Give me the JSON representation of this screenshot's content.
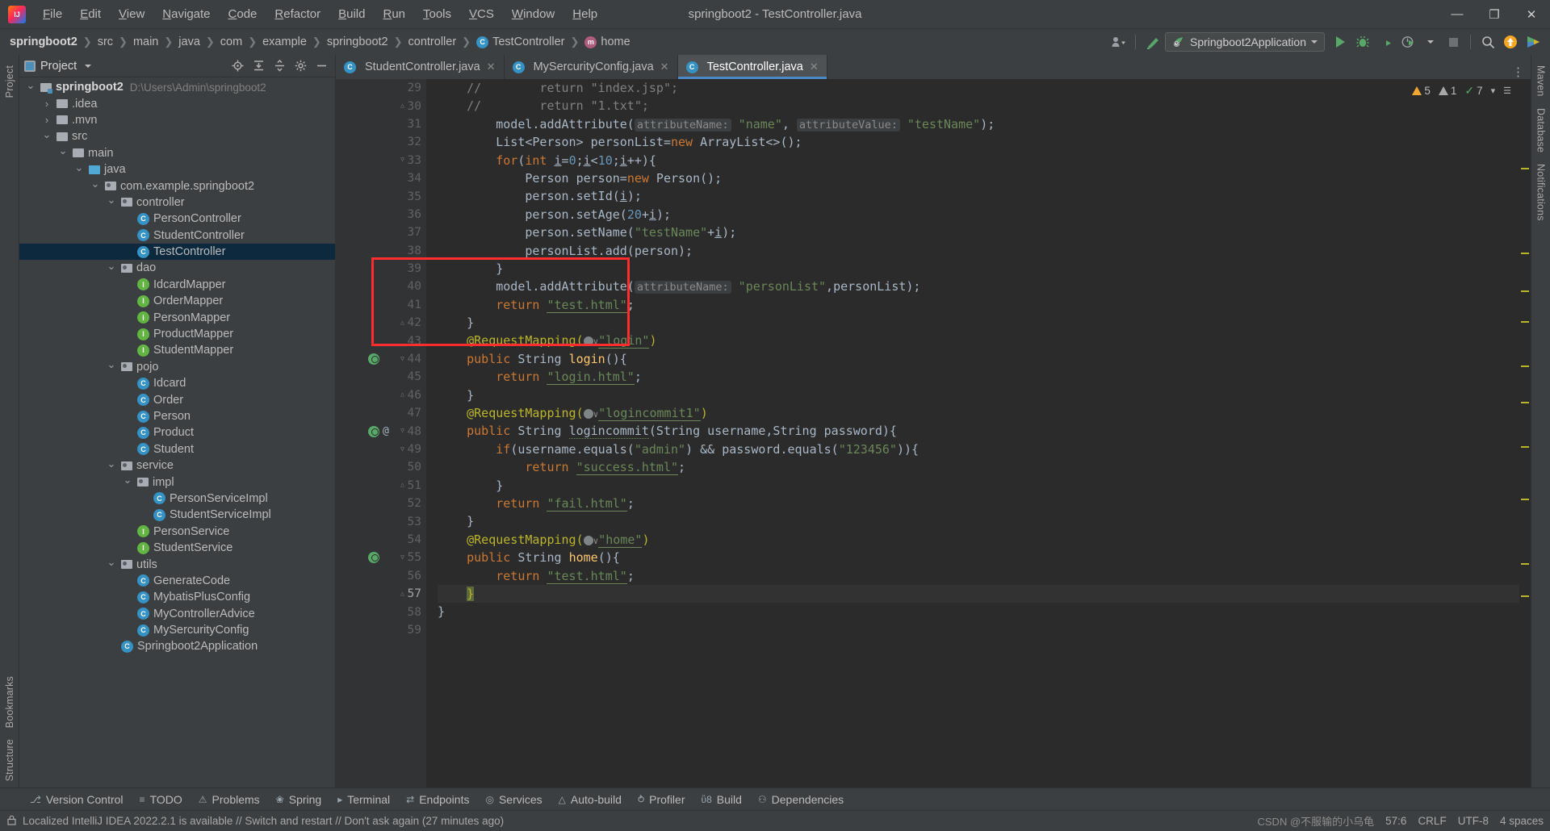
{
  "window": {
    "title": "springboot2 - TestController.java",
    "minimize": "—",
    "maximize": "❐",
    "close": "✕"
  },
  "menubar": {
    "items": [
      "File",
      "Edit",
      "View",
      "Navigate",
      "Code",
      "Refactor",
      "Build",
      "Run",
      "Tools",
      "VCS",
      "Window",
      "Help"
    ]
  },
  "navbar": {
    "crumbs": [
      {
        "label": "springboot2",
        "icon": "",
        "bold": true
      },
      {
        "label": "src",
        "icon": ""
      },
      {
        "label": "main",
        "icon": ""
      },
      {
        "label": "java",
        "icon": ""
      },
      {
        "label": "com",
        "icon": ""
      },
      {
        "label": "example",
        "icon": ""
      },
      {
        "label": "springboot2",
        "icon": ""
      },
      {
        "label": "controller",
        "icon": ""
      },
      {
        "label": "TestController",
        "icon": "class-icon",
        "badge": "C"
      },
      {
        "label": "home",
        "icon": "method-icon",
        "badge": "m"
      }
    ],
    "run_config": "Springboot2Application",
    "icons": {
      "profile": "user-account-icon",
      "hammer": "build-icon",
      "run": "run-icon",
      "debug": "debug-icon",
      "run_coverage": "run-with-coverage-icon",
      "profiler": "profiler-icon",
      "stop": "stop-icon",
      "search": "search-everywhere-icon",
      "update": "update-project-icon",
      "ide_feature": "ide-feature-trainer-icon"
    }
  },
  "project_panel": {
    "title": "Project",
    "tools": [
      "select-opened-file-icon",
      "expand-all-icon",
      "collapse-all-icon",
      "settings-icon",
      "hide-icon"
    ],
    "tree": [
      {
        "depth": 0,
        "label": "springboot2",
        "path": "D:\\Users\\Admin\\springboot2",
        "kind": "module",
        "arrow": "open",
        "bold": true
      },
      {
        "depth": 1,
        "label": ".idea",
        "kind": "folder",
        "arrow": "closed"
      },
      {
        "depth": 1,
        "label": ".mvn",
        "kind": "folder",
        "arrow": "closed"
      },
      {
        "depth": 1,
        "label": "src",
        "kind": "folder",
        "arrow": "open"
      },
      {
        "depth": 2,
        "label": "main",
        "kind": "folder",
        "arrow": "open"
      },
      {
        "depth": 3,
        "label": "java",
        "kind": "source-folder",
        "arrow": "open"
      },
      {
        "depth": 4,
        "label": "com.example.springboot2",
        "kind": "package",
        "arrow": "open"
      },
      {
        "depth": 5,
        "label": "controller",
        "kind": "package",
        "arrow": "open"
      },
      {
        "depth": 6,
        "label": "PersonController",
        "kind": "class"
      },
      {
        "depth": 6,
        "label": "StudentController",
        "kind": "class"
      },
      {
        "depth": 6,
        "label": "TestController",
        "kind": "class",
        "selected": true
      },
      {
        "depth": 5,
        "label": "dao",
        "kind": "package",
        "arrow": "open"
      },
      {
        "depth": 6,
        "label": "IdcardMapper",
        "kind": "interface"
      },
      {
        "depth": 6,
        "label": "OrderMapper",
        "kind": "interface"
      },
      {
        "depth": 6,
        "label": "PersonMapper",
        "kind": "interface"
      },
      {
        "depth": 6,
        "label": "ProductMapper",
        "kind": "interface"
      },
      {
        "depth": 6,
        "label": "StudentMapper",
        "kind": "interface"
      },
      {
        "depth": 5,
        "label": "pojo",
        "kind": "package",
        "arrow": "open"
      },
      {
        "depth": 6,
        "label": "Idcard",
        "kind": "class"
      },
      {
        "depth": 6,
        "label": "Order",
        "kind": "class"
      },
      {
        "depth": 6,
        "label": "Person",
        "kind": "class"
      },
      {
        "depth": 6,
        "label": "Product",
        "kind": "class"
      },
      {
        "depth": 6,
        "label": "Student",
        "kind": "class"
      },
      {
        "depth": 5,
        "label": "service",
        "kind": "package",
        "arrow": "open"
      },
      {
        "depth": 6,
        "label": "impl",
        "kind": "package",
        "arrow": "open"
      },
      {
        "depth": 7,
        "label": "PersonServiceImpl",
        "kind": "class"
      },
      {
        "depth": 7,
        "label": "StudentServiceImpl",
        "kind": "class"
      },
      {
        "depth": 6,
        "label": "PersonService",
        "kind": "interface"
      },
      {
        "depth": 6,
        "label": "StudentService",
        "kind": "interface"
      },
      {
        "depth": 5,
        "label": "utils",
        "kind": "package",
        "arrow": "open"
      },
      {
        "depth": 6,
        "label": "GenerateCode",
        "kind": "class"
      },
      {
        "depth": 6,
        "label": "MybatisPlusConfig",
        "kind": "class"
      },
      {
        "depth": 6,
        "label": "MyControllerAdvice",
        "kind": "class"
      },
      {
        "depth": 6,
        "label": "MySercurityConfig",
        "kind": "class"
      },
      {
        "depth": 5,
        "label": "Springboot2Application",
        "kind": "class-run"
      }
    ]
  },
  "editor": {
    "tabs": [
      {
        "label": "StudentController.java",
        "active": false,
        "badge": "C"
      },
      {
        "label": "MySercurityConfig.java",
        "active": false,
        "badge": "C"
      },
      {
        "label": "TestController.java",
        "active": true,
        "badge": "C"
      }
    ],
    "inspection": {
      "warnings": "5",
      "weak_warnings": "1",
      "typos": "7"
    },
    "first_line": 29,
    "lines": [
      {
        "n": 29,
        "indent": 0,
        "tokens": [
          {
            "t": "    ",
            "c": ""
          },
          {
            "t": "//",
            "c": "cmt"
          },
          {
            "t": "        return \"index.jsp\";",
            "c": "cmt"
          }
        ]
      },
      {
        "n": 30,
        "indent": 0,
        "fold": "end",
        "tokens": [
          {
            "t": "    ",
            "c": ""
          },
          {
            "t": "//",
            "c": "cmt"
          },
          {
            "t": "        return \"1.txt\";",
            "c": "cmt"
          }
        ]
      },
      {
        "n": 31,
        "tokens": [
          {
            "t": "        model.addAttribute(",
            "c": "fn"
          },
          {
            "t": "attributeName:",
            "c": "hint"
          },
          {
            "t": " ",
            "c": ""
          },
          {
            "t": "\"name\"",
            "c": "str"
          },
          {
            "t": ", ",
            "c": "fn"
          },
          {
            "t": "attributeValue:",
            "c": "hint"
          },
          {
            "t": " ",
            "c": ""
          },
          {
            "t": "\"testName\"",
            "c": "str"
          },
          {
            "t": ");",
            "c": "fn"
          }
        ]
      },
      {
        "n": 32,
        "tokens": [
          {
            "t": "        List<Person> personList=",
            "c": "fn"
          },
          {
            "t": "new",
            "c": "kw"
          },
          {
            "t": " ArrayList<>();",
            "c": "fn"
          }
        ]
      },
      {
        "n": 33,
        "fold": "start",
        "tokens": [
          {
            "t": "        ",
            "c": ""
          },
          {
            "t": "for",
            "c": "kw"
          },
          {
            "t": "(",
            "c": "fn"
          },
          {
            "t": "int",
            "c": "kw"
          },
          {
            "t": " ",
            "c": ""
          },
          {
            "t": "i",
            "c": "undl"
          },
          {
            "t": "=",
            "c": "fn"
          },
          {
            "t": "0",
            "c": "num"
          },
          {
            "t": ";",
            "c": "fn"
          },
          {
            "t": "i",
            "c": "undl"
          },
          {
            "t": "<",
            "c": "fn"
          },
          {
            "t": "10",
            "c": "num"
          },
          {
            "t": ";",
            "c": "fn"
          },
          {
            "t": "i",
            "c": "undl"
          },
          {
            "t": "++){",
            "c": "fn"
          }
        ]
      },
      {
        "n": 34,
        "tokens": [
          {
            "t": "            Person person=",
            "c": "fn"
          },
          {
            "t": "new",
            "c": "kw"
          },
          {
            "t": " Person();",
            "c": "fn"
          }
        ]
      },
      {
        "n": 35,
        "tokens": [
          {
            "t": "            person.setId(",
            "c": "fn"
          },
          {
            "t": "i",
            "c": "undl"
          },
          {
            "t": ");",
            "c": "fn"
          }
        ]
      },
      {
        "n": 36,
        "tokens": [
          {
            "t": "            person.setAge(",
            "c": "fn"
          },
          {
            "t": "20",
            "c": "num"
          },
          {
            "t": "+",
            "c": "fn"
          },
          {
            "t": "i",
            "c": "undl"
          },
          {
            "t": ");",
            "c": "fn"
          }
        ]
      },
      {
        "n": 37,
        "tokens": [
          {
            "t": "            person.setName(",
            "c": "fn"
          },
          {
            "t": "\"testName\"",
            "c": "str"
          },
          {
            "t": "+",
            "c": "fn"
          },
          {
            "t": "i",
            "c": "undl"
          },
          {
            "t": ");",
            "c": "fn"
          }
        ]
      },
      {
        "n": 38,
        "tokens": [
          {
            "t": "            personList.add(person);",
            "c": "fn"
          }
        ]
      },
      {
        "n": 39,
        "tokens": [
          {
            "t": "        }",
            "c": "fn"
          }
        ]
      },
      {
        "n": 40,
        "tokens": [
          {
            "t": "        model.addAttribute(",
            "c": "fn"
          },
          {
            "t": "attributeName:",
            "c": "hint"
          },
          {
            "t": " ",
            "c": ""
          },
          {
            "t": "\"personList\"",
            "c": "str"
          },
          {
            "t": ",personList);",
            "c": "fn"
          }
        ]
      },
      {
        "n": 41,
        "tokens": [
          {
            "t": "        ",
            "c": ""
          },
          {
            "t": "return",
            "c": "kw"
          },
          {
            "t": " ",
            "c": ""
          },
          {
            "t": "\"test.html\"",
            "c": "strl"
          },
          {
            "t": ";",
            "c": "fn"
          }
        ]
      },
      {
        "n": 42,
        "fold": "end",
        "tokens": [
          {
            "t": "    }",
            "c": "fn"
          }
        ]
      },
      {
        "n": 43,
        "tokens": [
          {
            "t": "    @RequestMapping(",
            "c": "ann"
          },
          {
            "t": "GLOBE",
            "c": "globe"
          },
          {
            "t": "\"login\"",
            "c": "strl"
          },
          {
            "t": ")",
            "c": "ann"
          }
        ]
      },
      {
        "n": 44,
        "run": true,
        "fold": "start",
        "tokens": [
          {
            "t": "    ",
            "c": ""
          },
          {
            "t": "public",
            "c": "kw"
          },
          {
            "t": " String ",
            "c": "cls"
          },
          {
            "t": "login",
            "c": "mth"
          },
          {
            "t": "(){",
            "c": "fn"
          }
        ]
      },
      {
        "n": 45,
        "tokens": [
          {
            "t": "        ",
            "c": ""
          },
          {
            "t": "return",
            "c": "kw"
          },
          {
            "t": " ",
            "c": ""
          },
          {
            "t": "\"login.html\"",
            "c": "strl"
          },
          {
            "t": ";",
            "c": "fn"
          }
        ]
      },
      {
        "n": 46,
        "fold": "end",
        "tokens": [
          {
            "t": "    }",
            "c": "fn"
          }
        ]
      },
      {
        "n": 47,
        "tokens": [
          {
            "t": "    @RequestMapping(",
            "c": "ann"
          },
          {
            "t": "GLOBE",
            "c": "globe"
          },
          {
            "t": "\"logincommit1\"",
            "c": "strl"
          },
          {
            "t": ")",
            "c": "ann"
          }
        ]
      },
      {
        "n": 48,
        "run": true,
        "at": true,
        "fold": "start",
        "tokens": [
          {
            "t": "    ",
            "c": ""
          },
          {
            "t": "public",
            "c": "kw"
          },
          {
            "t": " String ",
            "c": "cls"
          },
          {
            "t": "logincommit",
            "c": "squig"
          },
          {
            "t": "(String username,String password){",
            "c": "fn"
          }
        ]
      },
      {
        "n": 49,
        "fold": "start",
        "tokens": [
          {
            "t": "        ",
            "c": ""
          },
          {
            "t": "if",
            "c": "kw"
          },
          {
            "t": "(username.equals(",
            "c": "fn"
          },
          {
            "t": "\"admin\"",
            "c": "str"
          },
          {
            "t": ") && password.equals(",
            "c": "fn"
          },
          {
            "t": "\"123456\"",
            "c": "str"
          },
          {
            "t": ")){",
            "c": "fn"
          }
        ]
      },
      {
        "n": 50,
        "tokens": [
          {
            "t": "            ",
            "c": ""
          },
          {
            "t": "return",
            "c": "kw"
          },
          {
            "t": " ",
            "c": ""
          },
          {
            "t": "\"success.html\"",
            "c": "strl"
          },
          {
            "t": ";",
            "c": "fn"
          }
        ]
      },
      {
        "n": 51,
        "fold": "end",
        "tokens": [
          {
            "t": "        }",
            "c": "fn"
          }
        ]
      },
      {
        "n": 52,
        "tokens": [
          {
            "t": "        ",
            "c": ""
          },
          {
            "t": "return",
            "c": "kw"
          },
          {
            "t": " ",
            "c": ""
          },
          {
            "t": "\"fail.html\"",
            "c": "strl"
          },
          {
            "t": ";",
            "c": "fn"
          }
        ]
      },
      {
        "n": 53,
        "tokens": [
          {
            "t": "    }",
            "c": "fn"
          }
        ]
      },
      {
        "n": 54,
        "tokens": [
          {
            "t": "    @RequestMapping(",
            "c": "ann"
          },
          {
            "t": "GLOBE",
            "c": "globe"
          },
          {
            "t": "\"home\"",
            "c": "strl"
          },
          {
            "t": ")",
            "c": "ann"
          }
        ]
      },
      {
        "n": 55,
        "run": true,
        "fold": "start",
        "tokens": [
          {
            "t": "    ",
            "c": ""
          },
          {
            "t": "public",
            "c": "kw"
          },
          {
            "t": " String ",
            "c": "cls"
          },
          {
            "t": "home",
            "c": "mth"
          },
          {
            "t": "(){",
            "c": "fn"
          }
        ]
      },
      {
        "n": 56,
        "tokens": [
          {
            "t": "        ",
            "c": ""
          },
          {
            "t": "return",
            "c": "kw"
          },
          {
            "t": " ",
            "c": ""
          },
          {
            "t": "\"test.html\"",
            "c": "strl"
          },
          {
            "t": ";",
            "c": "fn"
          }
        ]
      },
      {
        "n": 57,
        "current": true,
        "fold": "end",
        "tokens": [
          {
            "t": "    ",
            "c": ""
          },
          {
            "t": "}",
            "c": "cursor-blk"
          }
        ]
      },
      {
        "n": 58,
        "tokens": [
          {
            "t": "}",
            "c": "fn"
          }
        ]
      },
      {
        "n": 59,
        "tokens": [
          {
            "t": "",
            "c": ""
          }
        ]
      }
    ]
  },
  "tool_windows": {
    "left_rail": [
      "Project",
      "Structure",
      "Bookmarks"
    ],
    "right_rail": [
      "Maven",
      "Database",
      "Notifications"
    ],
    "bottom": [
      {
        "label": "Version Control",
        "icon": "branch-icon"
      },
      {
        "label": "TODO",
        "icon": "todo-icon"
      },
      {
        "label": "Problems",
        "icon": "problems-icon"
      },
      {
        "label": "Spring",
        "icon": "spring-icon"
      },
      {
        "label": "Terminal",
        "icon": "terminal-icon"
      },
      {
        "label": "Endpoints",
        "icon": "endpoints-icon"
      },
      {
        "label": "Services",
        "icon": "services-icon"
      },
      {
        "label": "Auto-build",
        "icon": "auto-build-icon"
      },
      {
        "label": "Profiler",
        "icon": "profiler-icon"
      },
      {
        "label": "Build",
        "icon": "build-icon"
      },
      {
        "label": "Dependencies",
        "icon": "dependencies-icon"
      }
    ]
  },
  "statusbar": {
    "message": "Localized IntelliJ IDEA 2022.2.1 is available // Switch and restart // Don't ask again (27 minutes ago)",
    "caret": "57:6",
    "line_sep": "CRLF",
    "encoding": "UTF-8",
    "indent": "4 spaces",
    "lock": "lock-icon",
    "watermark": "CSDN @不服输的小乌龟"
  }
}
